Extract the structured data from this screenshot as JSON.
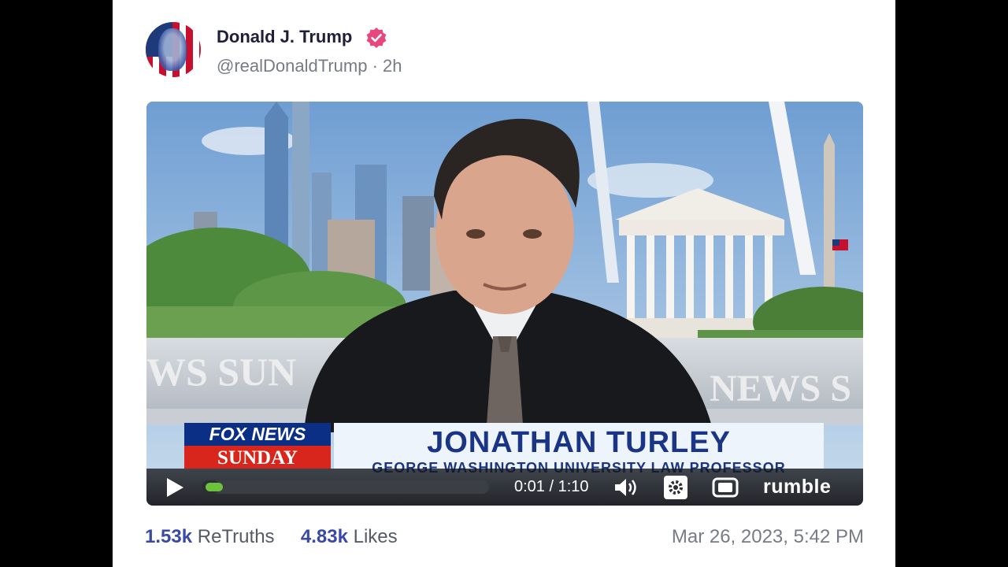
{
  "post": {
    "author_name": "Donald J. Trump",
    "handle_time": "@realDonaldTrump · 2h",
    "date": "Mar 26, 2023, 5:42 PM"
  },
  "video": {
    "chyron_network": "FOX NEWS",
    "chyron_show": "SUNDAY",
    "chyron_name": "JONATHAN TURLEY",
    "chyron_subtitle": "GEORGE WASHINGTON UNIVERSITY LAW PROFESSOR",
    "background_text_left": "WS  SUN",
    "background_text_right": "NEWS  S",
    "time": "0:01 / 1:10",
    "progress_fraction": 0.014,
    "brand": "rumble"
  },
  "stats": {
    "retruths_count": "1.53k",
    "retruths_label": "ReTruths",
    "likes_count": "4.83k",
    "likes_label": "Likes"
  },
  "icons": [
    "verified-badge-icon",
    "play-icon",
    "volume-icon",
    "settings-gear-icon",
    "fullscreen-icon"
  ],
  "colors": {
    "verified": "#e8467c",
    "accent": "#3a49a8",
    "progress": "#6bc33c"
  }
}
